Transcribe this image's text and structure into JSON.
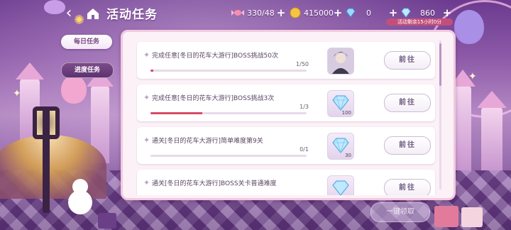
{
  "header": {
    "title": "活动任务",
    "resources": [
      {
        "icon": "candy-icon",
        "value": "330/48"
      },
      {
        "icon": "coin-icon",
        "value": "415000"
      },
      {
        "icon": "gem-blue-icon",
        "value": "0"
      },
      {
        "icon": "diamond-icon",
        "value": "860"
      }
    ],
    "timer": "活动剩余15小时0分"
  },
  "tabs": {
    "daily": "每日任务",
    "progress": "进度任务"
  },
  "tasks": [
    {
      "name": "完成任意[冬日的花车大游行]BOSS挑战50次",
      "progress": "1/50",
      "ratio": 0.02,
      "reward": "portrait",
      "reward_qty": "",
      "button": "前往"
    },
    {
      "name": "完成任意[冬日的花车大游行]BOSS挑战3次",
      "progress": "1/3",
      "ratio": 0.333,
      "reward": "diamond",
      "reward_qty": "100",
      "button": "前往"
    },
    {
      "name": "通关[冬日的花车大游行]简单难度第9关",
      "progress": "0/1",
      "ratio": 0,
      "reward": "diamond",
      "reward_qty": "30",
      "button": "前往"
    },
    {
      "name": "通关[冬日的花车大游行]BOSS关卡普通难度",
      "progress": "",
      "ratio": 0,
      "reward": "diamond",
      "reward_qty": "",
      "button": "前往"
    }
  ],
  "footer": {
    "claim_all": "一键领取"
  },
  "colors": {
    "accent": "#d64b67",
    "panel": "#fbf1f6",
    "tab_active": "#7c4c8a"
  }
}
